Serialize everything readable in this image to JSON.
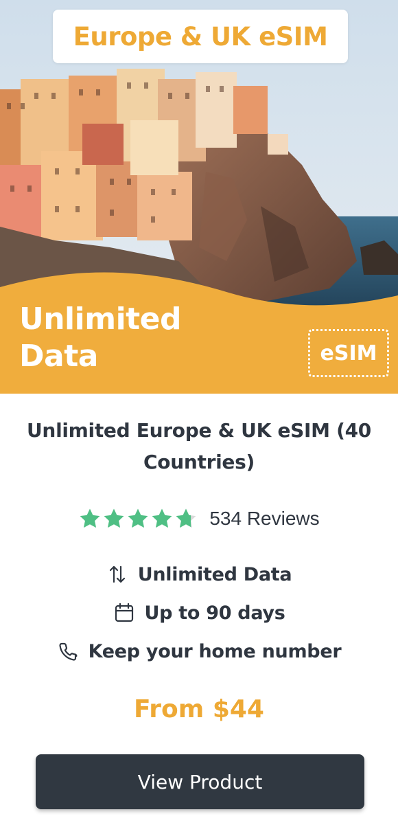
{
  "banner": {
    "title": "Europe & UK eSIM",
    "overlay_line1": "Unlimited",
    "overlay_line2": "Data",
    "badge": "eSIM",
    "accent_color": "#eea935"
  },
  "product": {
    "name": "Unlimited Europe & UK eSIM (40 Countries)",
    "rating": {
      "stars": 4.7,
      "max_stars": 5,
      "reviews_label": "534 Reviews",
      "star_color": "#4fbf84"
    },
    "features": [
      {
        "icon": "arrows-up-down-icon",
        "label": "Unlimited Data"
      },
      {
        "icon": "calendar-icon",
        "label": "Up to 90 days"
      },
      {
        "icon": "phone-icon",
        "label": "Keep your home number"
      }
    ],
    "price_label": "From $44",
    "cta_label": "View Product",
    "cta_color": "#303841"
  }
}
